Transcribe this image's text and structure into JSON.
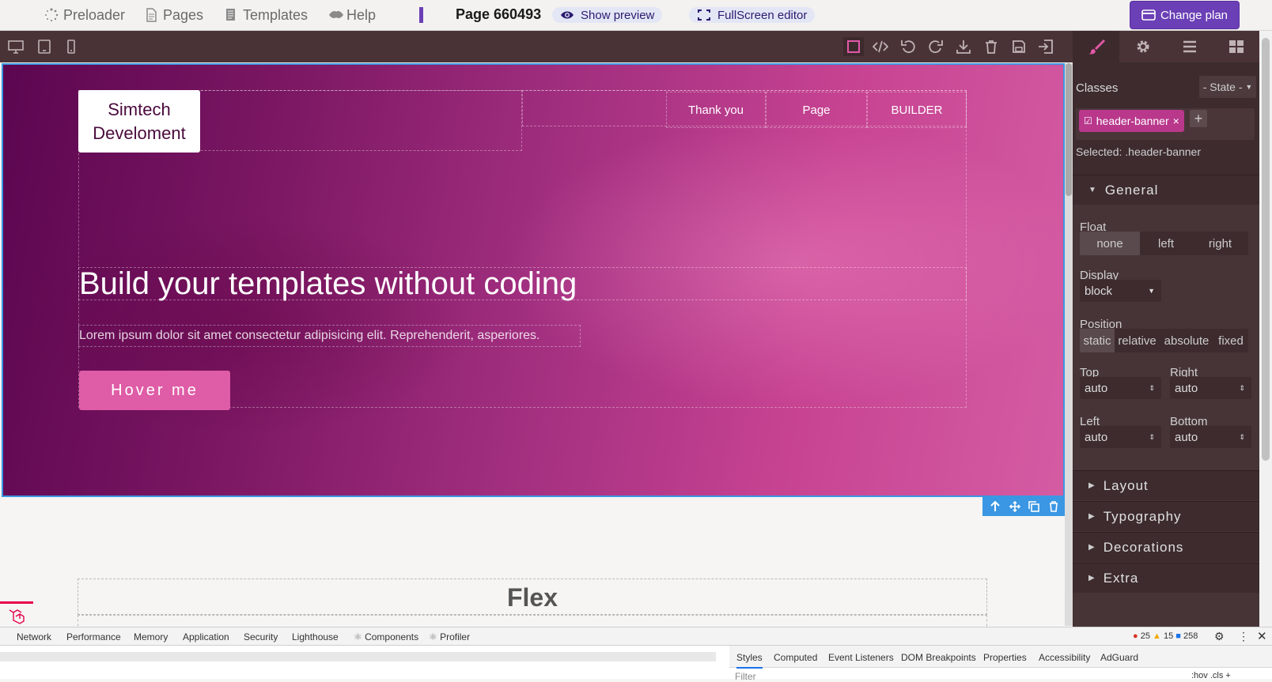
{
  "topbar": {
    "nav": [
      {
        "label": "Preloader",
        "icon": "spinner-icon"
      },
      {
        "label": "Pages",
        "icon": "file-icon"
      },
      {
        "label": "Templates",
        "icon": "template-icon"
      },
      {
        "label": "Help",
        "icon": "help-icon"
      }
    ],
    "page_title": "Page 660493",
    "show_preview": "Show preview",
    "fullscreen": "FullScreen editor",
    "change_plan": "Change plan"
  },
  "canvas": {
    "logo_line1": "Simtech",
    "logo_line2": "Develoment",
    "nav_links": [
      "Thank you",
      "Page",
      "BUILDER"
    ],
    "headline": "Build your templates without coding",
    "lorem": "Lorem ipsum dolor sit amet consectetur adipisicing elit. Reprehenderit, asperiores.",
    "button": "Hover me",
    "flex_title": "Flex"
  },
  "panel": {
    "classes_label": "Classes",
    "state": "- State -",
    "tag": "header-banner",
    "selected": "Selected:  .header-banner",
    "sectors": [
      "General",
      "Layout",
      "Typography",
      "Decorations",
      "Extra"
    ],
    "float_label": "Float",
    "float_options": [
      "none",
      "left",
      "right"
    ],
    "float_selected": "none",
    "display_label": "Display",
    "display_value": "block",
    "position_label": "Position",
    "position_options": [
      "static",
      "relative",
      "absolute",
      "fixed"
    ],
    "position_selected": "static",
    "top_label": "Top",
    "top_value": "auto",
    "right_label": "Right",
    "right_value": "auto",
    "left_label": "Left",
    "left_value": "auto",
    "bottom_label": "Bottom",
    "bottom_value": "auto"
  },
  "devtools": {
    "tabs": [
      "Network",
      "Performance",
      "Memory",
      "Application",
      "Security",
      "Lighthouse",
      "Components",
      "Profiler"
    ],
    "errors": "25",
    "warnings": "15",
    "messages": "258",
    "subtabs": [
      "Styles",
      "Computed",
      "Event Listeners",
      "DOM Breakpoints",
      "Properties",
      "Accessibility",
      "AdGuard"
    ],
    "filter_placeholder": "Filter",
    "hov_cls": ":hov  .cls  +"
  },
  "colors": {
    "accent": "#6b3fb5",
    "banner_pink": "#c74392",
    "button_pink": "#df5ca6",
    "selection_blue": "#3b97e3",
    "panel_bg": "#463436",
    "tag_pink": "#b9388c"
  }
}
